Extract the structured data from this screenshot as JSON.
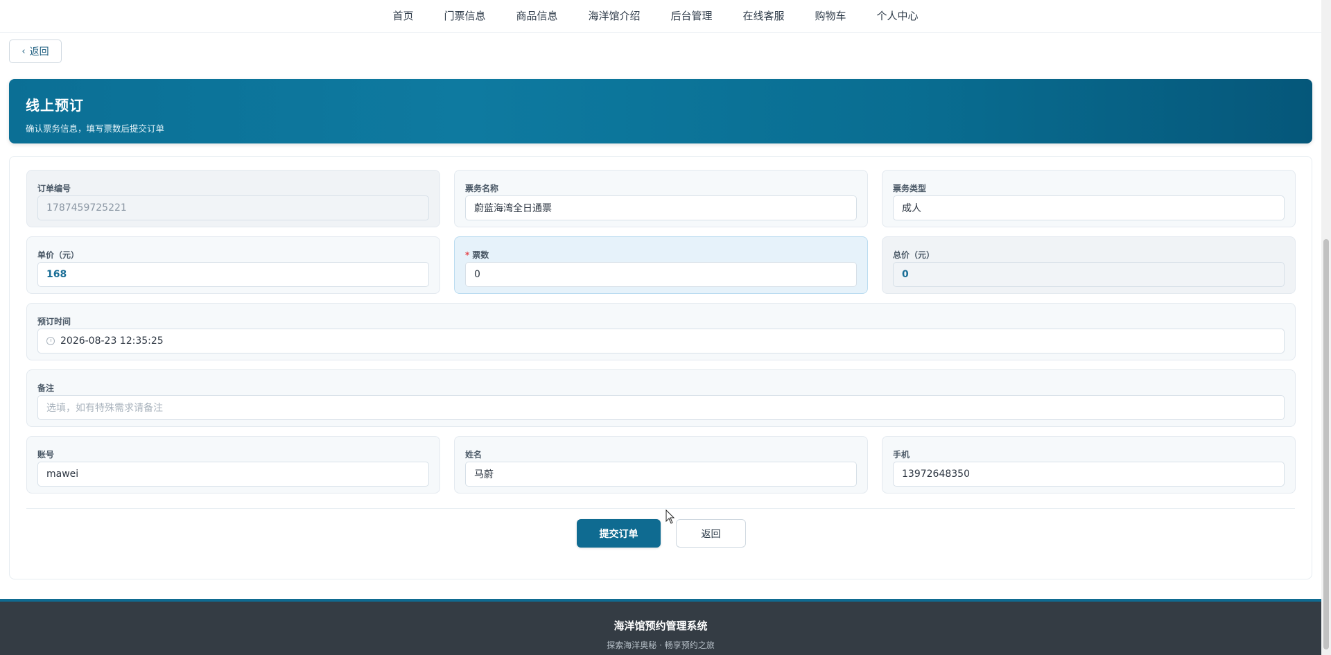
{
  "nav": {
    "items": [
      "首页",
      "门票信息",
      "商品信息",
      "海洋馆介绍",
      "后台管理",
      "在线客服",
      "购物车",
      "个人中心"
    ]
  },
  "back_button": {
    "label": "返回"
  },
  "banner": {
    "title": "线上预订",
    "subtitle": "确认票务信息，填写票数后提交订单"
  },
  "form": {
    "order_no": {
      "label": "订单编号",
      "value": "1787459725221"
    },
    "ticket_name": {
      "label": "票务名称",
      "value": "蔚蓝海湾全日通票"
    },
    "ticket_type": {
      "label": "票务类型",
      "value": "成人"
    },
    "unit_price": {
      "label": "单价（元）",
      "value": "168"
    },
    "quantity": {
      "label": "票数",
      "required_mark": "*",
      "value": "0"
    },
    "total_price": {
      "label": "总价（元）",
      "value": "0"
    },
    "booking_time": {
      "label": "预订时间",
      "value": "2026-08-23 12:35:25"
    },
    "remark": {
      "label": "备注",
      "placeholder": "选填，如有特殊需求请备注"
    },
    "account": {
      "label": "账号",
      "value": "mawei"
    },
    "name": {
      "label": "姓名",
      "value": "马蔚"
    },
    "phone": {
      "label": "手机",
      "value": "13972648350"
    }
  },
  "actions": {
    "submit_label": "提交订单",
    "back_label": "返回"
  },
  "footer": {
    "title": "海洋馆预约管理系统",
    "subtitle": "探索海洋奥秘 · 畅享预约之旅"
  },
  "colors": {
    "primary": "#0f6b91",
    "banner_start": "#0b6f95",
    "banner_end": "#05577a",
    "footer_bg": "#343c44",
    "required": "#e5484d"
  }
}
